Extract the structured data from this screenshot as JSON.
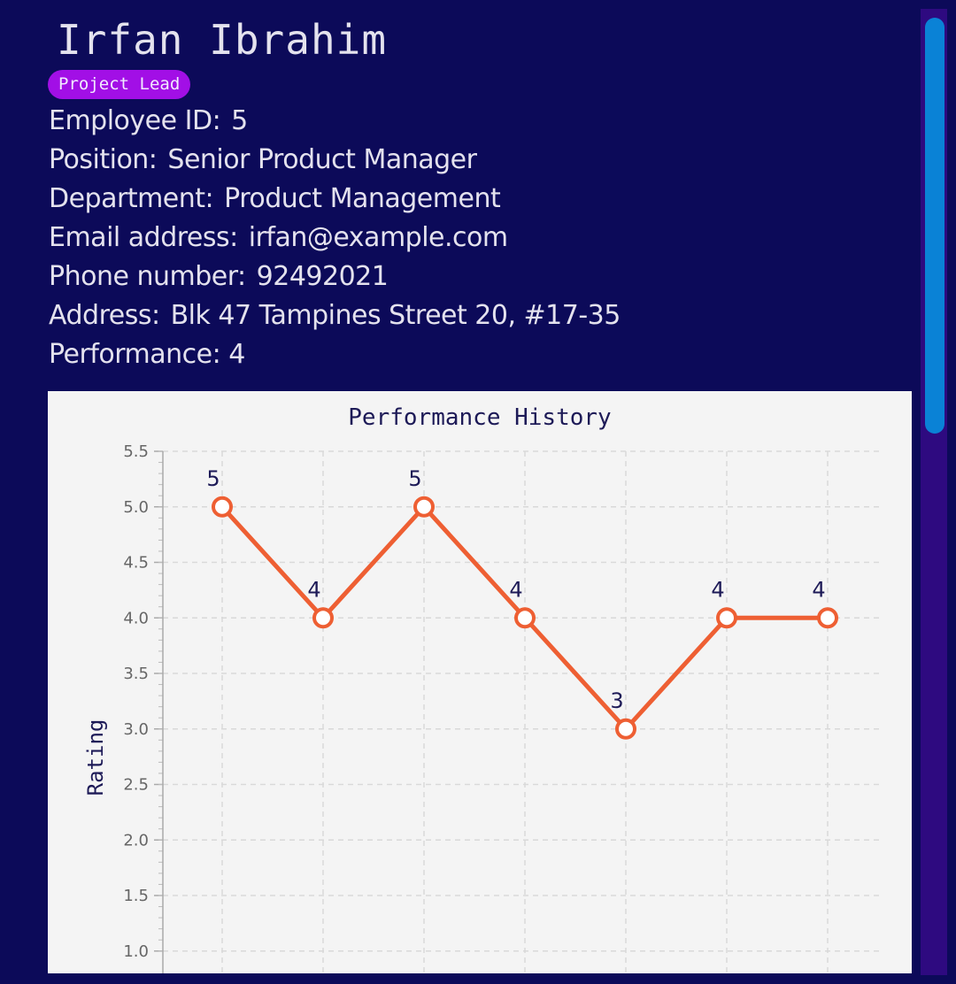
{
  "profile": {
    "name": "Irfan Ibrahim",
    "tag": "Project Lead",
    "fields": [
      {
        "label": "Employee ID:",
        "value": "5"
      },
      {
        "label": "Position:",
        "value": "Senior Product Manager"
      },
      {
        "label": "Department:",
        "value": "Product Management"
      },
      {
        "label": "Email address:",
        "value": "irfan@example.com"
      },
      {
        "label": "Phone number:",
        "value": "92492021"
      },
      {
        "label": "Address:",
        "value": "Blk 47 Tampines Street 20, #17-35"
      }
    ],
    "performance_label": "Performance:",
    "performance_value": "4"
  },
  "colors": {
    "background": "#0c0a59",
    "tag": "#a20fe6",
    "line": "#ee5f33",
    "scrollbar_thumb": "#0a82d6",
    "scrollbar_track": "#2e0a80"
  },
  "chart_data": {
    "type": "line",
    "title": "Performance History",
    "xlabel": "",
    "ylabel": "Rating",
    "ylim": [
      1.0,
      5.5
    ],
    "yticks": [
      "1.0",
      "1.5",
      "2.0",
      "2.5",
      "3.0",
      "3.5",
      "4.0",
      "4.5",
      "5.0",
      "5.5"
    ],
    "grid": true,
    "series": [
      {
        "values": [
          5,
          4,
          5,
          4,
          3,
          4,
          4
        ]
      }
    ]
  }
}
